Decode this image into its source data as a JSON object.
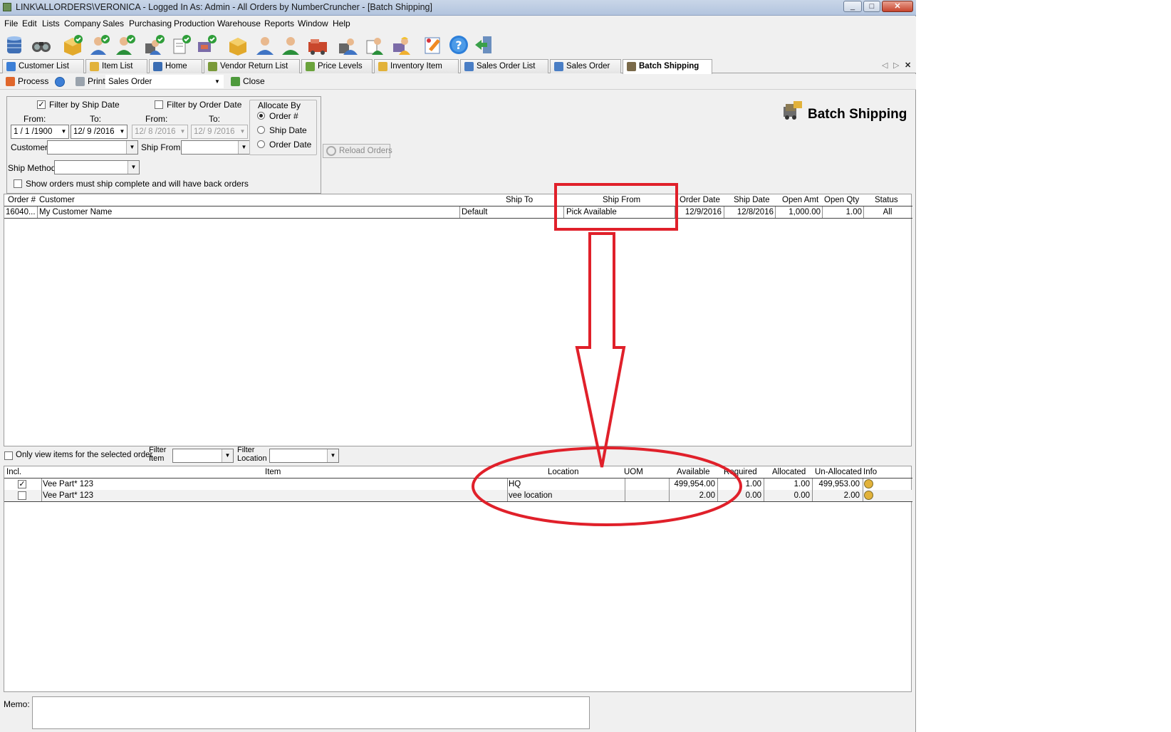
{
  "window": {
    "title": "LINK\\ALLORDERS\\VERONICA - Logged In As: Admin - All Orders by NumberCruncher - [Batch Shipping]",
    "controls": [
      "_",
      "□",
      "✕"
    ]
  },
  "menu": [
    "File",
    "Edit",
    "Lists",
    "Company",
    "Sales",
    "Purchasing",
    "Production",
    "Warehouse",
    "Reports",
    "Window",
    "Help"
  ],
  "tabs": [
    {
      "label": "Customer List",
      "color": "#3d7fd6"
    },
    {
      "label": "Item List",
      "color": "#e2b23a"
    },
    {
      "label": "Home",
      "color": "#3b6db3"
    },
    {
      "label": "Vendor Return List",
      "color": "#7a9a3a"
    },
    {
      "label": "Price Levels",
      "color": "#6aa33c"
    },
    {
      "label": "Inventory Item",
      "color": "#e2b23a"
    },
    {
      "label": "Sales Order List",
      "color": "#4a7ec5"
    },
    {
      "label": "Sales Order",
      "color": "#4a7ec5"
    },
    {
      "label": "Batch Shipping",
      "color": "#7a6a4a"
    }
  ],
  "actions": {
    "process": "Process",
    "print": "Print",
    "print_doc": "Sales Order",
    "close": "Close"
  },
  "filter": {
    "filter_ship_date": "Filter by Ship Date",
    "filter_order_date": "Filter by Order Date",
    "from1": "From:",
    "to1": "To:",
    "from2": "From:",
    "to2": "To:",
    "ship_from_date": "1 / 1 /1900",
    "ship_to_date": "12/ 9 /2016",
    "order_from_date": "12/ 8 /2016",
    "order_to_date": "12/ 9 /2016",
    "customer_label": "Customer:",
    "ship_from_label": "Ship From:",
    "ship_method_label": "Ship Method:",
    "show_backorders": "Show orders must ship complete and will have back orders",
    "allocate_by": "Allocate By",
    "opt_order": "Order #",
    "opt_ship_date": "Ship Date",
    "opt_order_date": "Order Date",
    "reload": "Reload Orders"
  },
  "heading": "Batch Shipping",
  "orders": {
    "columns": [
      "Order #",
      "Customer",
      "Ship To",
      "Ship From",
      "Order Date",
      "Ship Date",
      "Open Amt",
      "Open Qty",
      "Status"
    ],
    "rows": [
      {
        "order": "16040...",
        "customer": "My Customer Name",
        "ship_to": "Default",
        "ship_from": "Pick Available",
        "order_date": "12/9/2016",
        "ship_date": "12/8/2016",
        "open_amt": "1,000.00",
        "open_qty": "1.00",
        "status": "All"
      }
    ]
  },
  "items_filter": {
    "only_selected": "Only view items for the selected order",
    "filter_item_1": "Filter",
    "filter_item_2": "Item",
    "filter_location_1": "Filter",
    "filter_location_2": "Location"
  },
  "items": {
    "columns": [
      "Incl.",
      "Item",
      "Location",
      "UOM",
      "Available",
      "Required",
      "Allocated",
      "Un-Allocated",
      "Info"
    ],
    "rows": [
      {
        "incl": true,
        "item": "Vee Part* 123",
        "location": "HQ",
        "uom": "",
        "available": "499,954.00",
        "required": "1.00",
        "allocated": "1.00",
        "unallocated": "499,953.00"
      },
      {
        "incl": false,
        "item": "Vee Part* 123",
        "location": "vee location",
        "uom": "",
        "available": "2.00",
        "required": "0.00",
        "allocated": "0.00",
        "unallocated": "2.00"
      }
    ]
  },
  "memo_label": "Memo:",
  "annotation_color": "#e0202a"
}
